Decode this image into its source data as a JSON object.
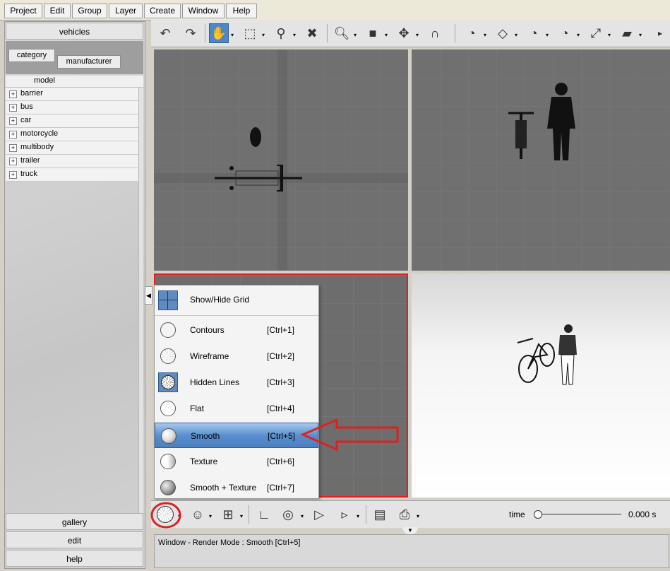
{
  "menubar": [
    "Project",
    "Edit",
    "Group",
    "Layer",
    "Create",
    "Window",
    "Help"
  ],
  "left_panel": {
    "header": "vehicles",
    "tabs": [
      "category",
      "manufacturer"
    ],
    "column_header": "model",
    "tree_items": [
      "barrier",
      "bus",
      "car",
      "motorcycle",
      "multibody",
      "trailer",
      "truck"
    ],
    "bottom_buttons": [
      "gallery",
      "edit",
      "help"
    ]
  },
  "toolbar_icons": [
    "undo-icon",
    "redo-icon",
    "pan-hand-icon",
    "select-box-icon",
    "move-icon",
    "delete-icon",
    "zoom-icon",
    "cube-view-icon",
    "move-axes-icon",
    "magnet-icon",
    "protractor-icon",
    "plane-icon",
    "angle-icon",
    "angle2-icon",
    "measure-icon",
    "ruler-icon"
  ],
  "render_menu": {
    "items": [
      {
        "label": "Show/Hide Grid",
        "shortcut": "",
        "icon": "grid-icon"
      },
      {
        "label": "Contours",
        "shortcut": "[Ctrl+1]",
        "icon": "contours-icon"
      },
      {
        "label": "Wireframe",
        "shortcut": "[Ctrl+2]",
        "icon": "wireframe-icon"
      },
      {
        "label": "Hidden Lines",
        "shortcut": "[Ctrl+3]",
        "icon": "hidden-lines-icon"
      },
      {
        "label": "Flat",
        "shortcut": "[Ctrl+4]",
        "icon": "flat-icon"
      },
      {
        "label": "Smooth",
        "shortcut": "[Ctrl+5]",
        "icon": "smooth-icon"
      },
      {
        "label": "Texture",
        "shortcut": "[Ctrl+6]",
        "icon": "texture-icon"
      },
      {
        "label": "Smooth + Texture",
        "shortcut": "[Ctrl+7]",
        "icon": "smooth-texture-icon"
      }
    ],
    "selected_index": 5
  },
  "bottom_toolbar": {
    "time_label": "time",
    "time_value": "0.000 s"
  },
  "status_text": "Window - Render Mode : Smooth [Ctrl+5]",
  "colors": {
    "highlight": "#4f86c6",
    "annotation_red": "#e02020"
  }
}
